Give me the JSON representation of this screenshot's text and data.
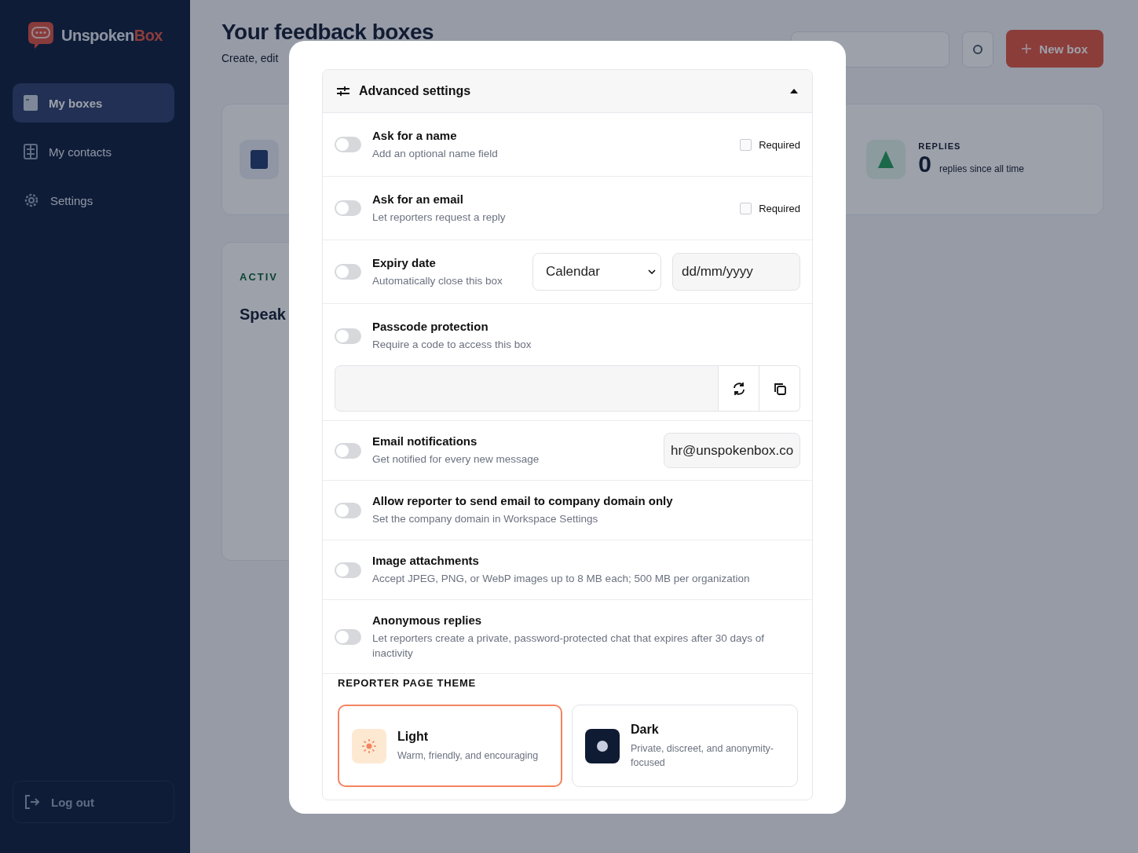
{
  "sidebar": {
    "logo": {
      "name": "Unspoken",
      "accent": "Box"
    },
    "items": [
      {
        "label": "My boxes",
        "kind": "boxes",
        "selected": true
      },
      {
        "label": "My contacts",
        "kind": "contacts",
        "selected": false
      },
      {
        "label": "Settings",
        "kind": "settings",
        "selected": false
      }
    ],
    "logout": "Log out"
  },
  "header": {
    "title": "Your feedback boxes",
    "subtitle": "Create, edit",
    "new_button": "New box"
  },
  "stats": {
    "replies_label": "REPLIES",
    "replies_value": "0",
    "replies_caption": "replies since all time"
  },
  "box_card": {
    "status": "ACTIV",
    "title": "Speak"
  },
  "modal": {
    "section_title": "Advanced settings",
    "expanded": true,
    "settings": [
      {
        "kind": "required",
        "title": "Ask for a name",
        "description": "Add an optional name field",
        "on": false,
        "required": {
          "label": "Required",
          "checked": false
        }
      },
      {
        "kind": "required",
        "title": "Ask for an email",
        "description": "Let reporters request a reply",
        "on": false,
        "required": {
          "label": "Required",
          "checked": false
        }
      },
      {
        "kind": "expiry",
        "title": "Expiry date",
        "description": "Automatically close this box",
        "on": false,
        "select": "Calendar",
        "date_placeholder": "dd/mm/yyyy"
      },
      {
        "kind": "passcode",
        "title": "Passcode protection",
        "description": "Require a code to access this box",
        "on": false
      },
      {
        "kind": "email",
        "title": "Email notifications",
        "description": "Get notified for every new message",
        "on": false,
        "email": "hr@unspokenbox.co"
      },
      {
        "kind": "plain",
        "title": "Allow reporter to send email to company domain only",
        "description": "Set the company domain in Workspace Settings",
        "on": false
      },
      {
        "kind": "plain",
        "title": "Image attachments",
        "description": "Accept JPEG, PNG, or WebP images up to 8 MB each; 500 MB per organization",
        "on": false
      },
      {
        "kind": "plain",
        "title": "Anonymous replies",
        "description": "Let reporters create a private, password-protected chat that expires after 30 days of inactivity",
        "on": false
      }
    ],
    "theme_label": "REPORTER PAGE THEME",
    "themes": [
      {
        "kind": "light",
        "name": "Light",
        "description": "Warm, friendly, and encouraging",
        "selected": true
      },
      {
        "kind": "dark",
        "name": "Dark",
        "description": "Private, discreet, and anonymity-focused",
        "selected": false
      }
    ]
  }
}
